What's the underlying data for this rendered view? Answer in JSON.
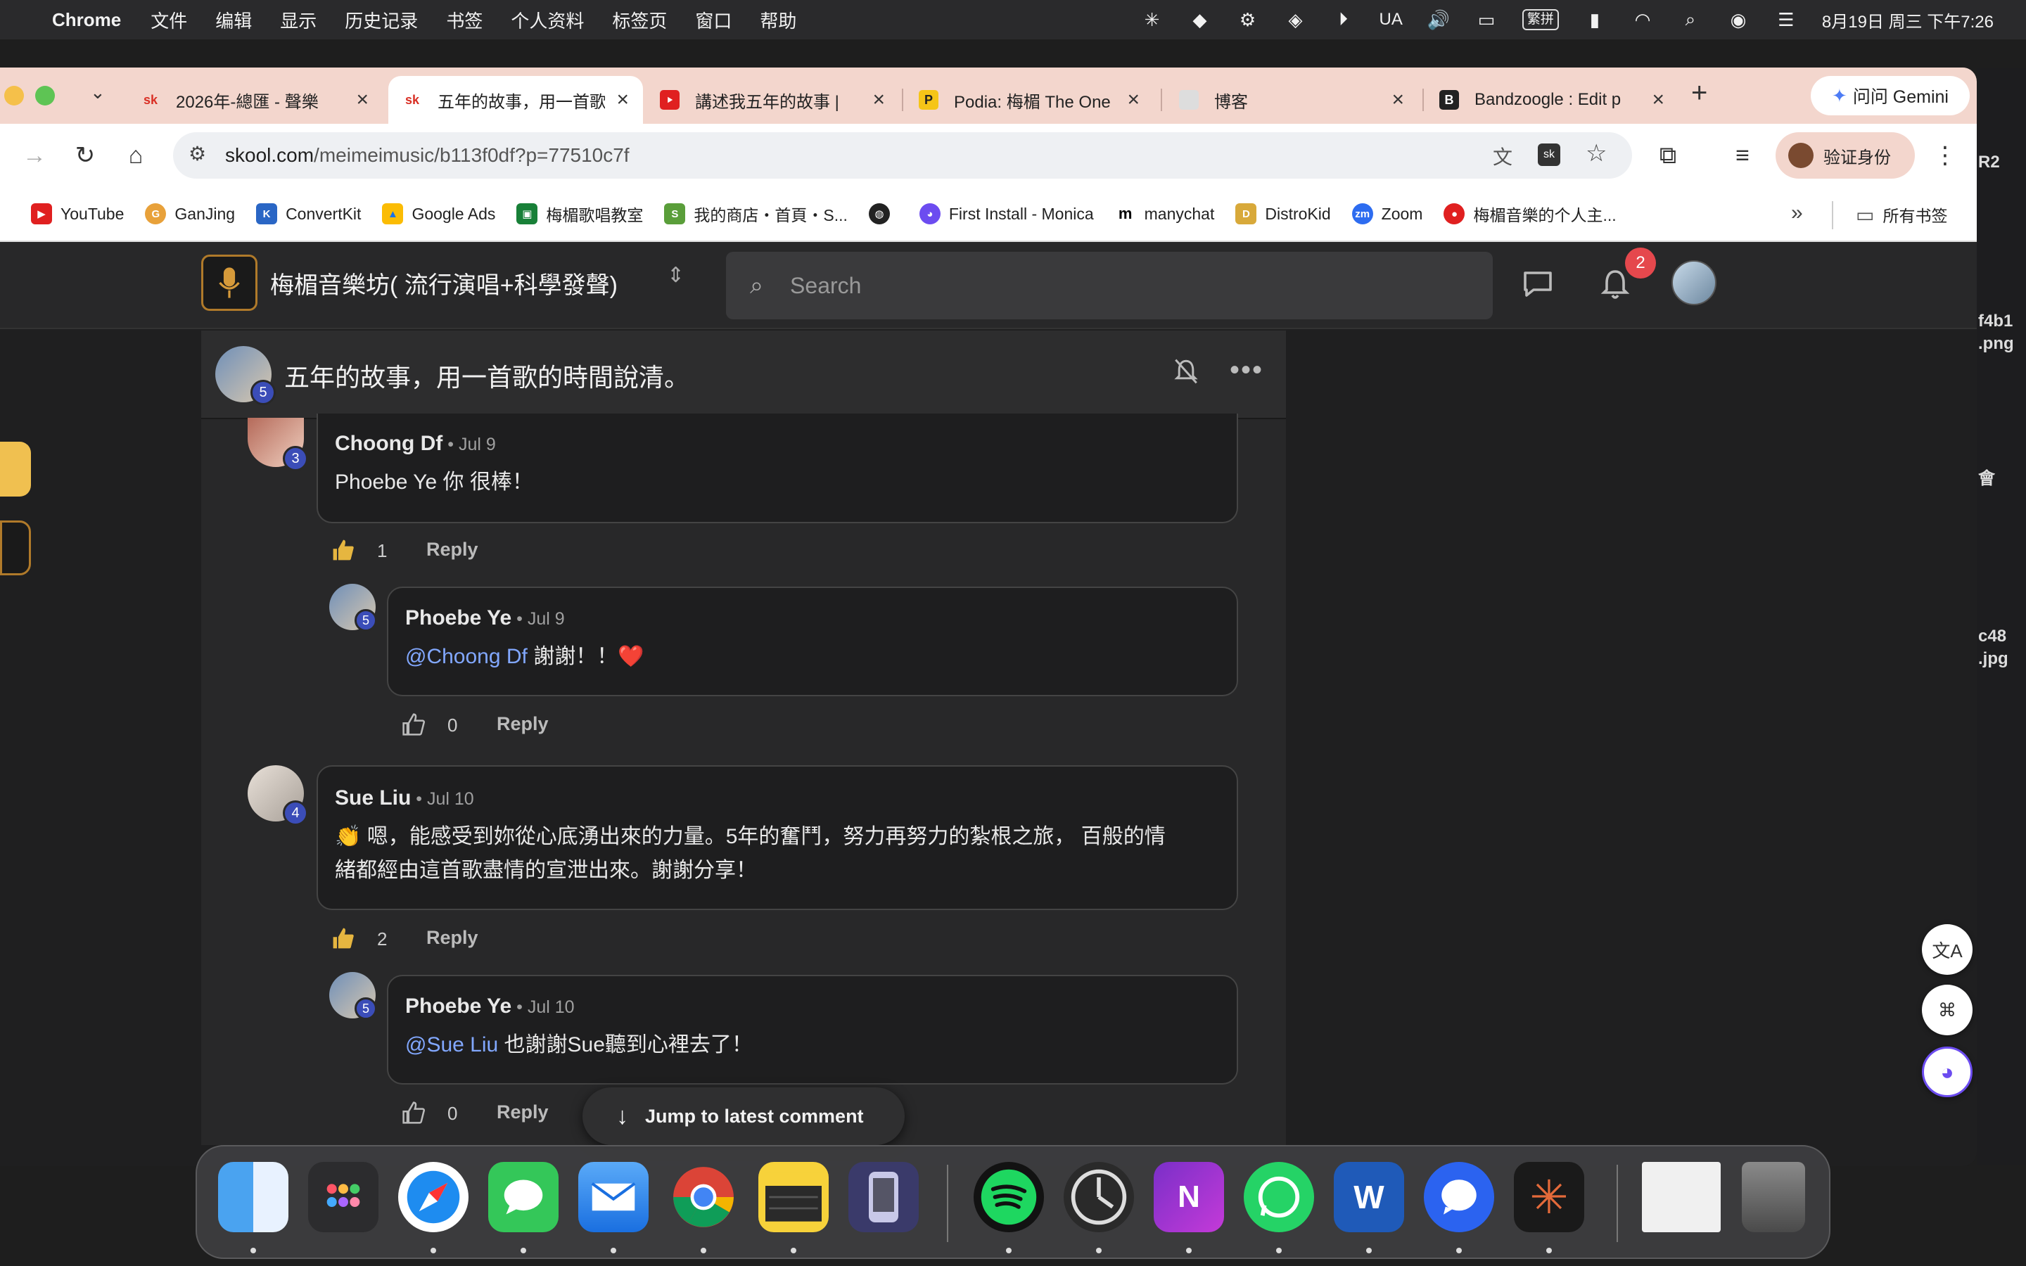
{
  "menubar": {
    "app": "Chrome",
    "items": [
      "文件",
      "编辑",
      "显示",
      "历史记录",
      "书签",
      "个人资料",
      "标签页",
      "窗口",
      "帮助"
    ],
    "status": {
      "input_method": "UA",
      "lang_badge": "繁拼",
      "datetime": "8月19日 周三 下午7:26"
    }
  },
  "desktop_files": [
    "R2",
    "f4b1",
    ".png",
    "會",
    "c48",
    ".jpg"
  ],
  "tabs": [
    {
      "title": "2026年-總匯 - 聲樂",
      "favicon": "sk"
    },
    {
      "title": "五年的故事，用一首歌",
      "favicon": "sk"
    },
    {
      "title": "講述我五年的故事 | ",
      "favicon": "youtube"
    },
    {
      "title": "Podia: 梅楣 The One",
      "favicon": "P"
    },
    {
      "title": "博客",
      "favicon": "doc"
    },
    {
      "title": "Bandzoogle : Edit p",
      "favicon": "B"
    }
  ],
  "gemini_label": "问问 Gemini",
  "address": {
    "host": "skool.com",
    "path": "/meimeimusic/b113f0df?p=77510c7f"
  },
  "verify_label": "验证身份",
  "bookmarks": [
    "YouTube",
    "GanJing",
    "ConvertKit",
    "Google Ads",
    "梅楣歌唱教室",
    "我的商店・首頁・S...",
    "",
    "First Install - Monica",
    "manychat",
    "DistroKid",
    "Zoom",
    "梅楣音樂的个人主..."
  ],
  "bookmarks_folder": "所有书签",
  "skool": {
    "group_name": "梅楣音樂坊( 流行演唱+科學發聲)",
    "search_placeholder": "Search",
    "notif_count": "2",
    "post": {
      "title": "五年的故事，用一首歌的時間說清。",
      "author_level": "5",
      "comments": [
        {
          "name": "Choong Df",
          "date": "Jul 9",
          "level": "3",
          "text": "Phoebe Ye 你 很棒！",
          "likes": "1",
          "reply": "Reply"
        },
        {
          "name": "Phoebe Ye",
          "date": "Jul 9",
          "level": "5",
          "mention": "@Choong Df",
          "text": " 謝謝！！❤️",
          "likes": "0",
          "reply": "Reply"
        },
        {
          "name": "Sue Liu",
          "date": "Jul 10",
          "level": "4",
          "text_l1": "👏 嗯，能感受到妳從心底湧出來的力量。5年的奮鬥，努力再努力的紮根之旅， 百般的情",
          "text_l2": "緒都經由這首歌盡情的宣泄出來。謝謝分享！",
          "likes": "2",
          "reply": "Reply"
        },
        {
          "name": "Phoebe Ye",
          "date": "Jul 10",
          "level": "5",
          "mention": "@Sue Liu",
          "text": " 也謝謝Sue聽到心裡去了！",
          "likes": "0",
          "reply": "Reply"
        }
      ],
      "jump_label": "Jump to latest comment"
    }
  },
  "colors": {
    "tab_strip": "#f3d6cd",
    "mention": "#82a8ff",
    "level_badge": "#3b4db8",
    "notif_badge": "#e5484d"
  }
}
